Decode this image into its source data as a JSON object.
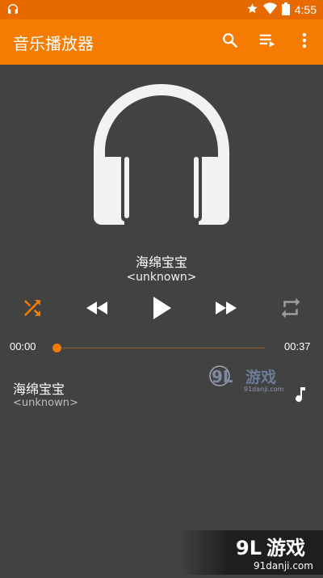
{
  "status_bar": {
    "time": "4:55",
    "icons": [
      "headphones-icon",
      "star-icon",
      "wifi-icon",
      "battery-icon"
    ]
  },
  "app_bar": {
    "title": "音乐播放器",
    "color": "#F57C00",
    "actions": [
      "search-icon",
      "playlist-icon",
      "more-vert-icon"
    ]
  },
  "now_playing": {
    "title": "海绵宝宝",
    "artist": "<unknown>",
    "art_icon": "headphones-icon"
  },
  "controls": {
    "shuffle": {
      "icon": "shuffle-icon",
      "active": true,
      "color": "#F57C00"
    },
    "previous": {
      "icon": "rewind-icon"
    },
    "play": {
      "icon": "play-icon"
    },
    "next": {
      "icon": "fast-forward-icon"
    },
    "repeat": {
      "icon": "repeat-icon",
      "active": false
    }
  },
  "progress": {
    "elapsed": "00:00",
    "duration": "00:37",
    "fraction": 0
  },
  "playlist": [
    {
      "title": "海绵宝宝",
      "artist": "<unknown>",
      "icon": "music-note-icon"
    }
  ],
  "watermarks": {
    "middle": {
      "logo": "9L",
      "name": "游戏",
      "url": "91danji.com"
    },
    "corner": {
      "logo": "9L",
      "name": "游戏",
      "url": "91danji.com"
    }
  }
}
